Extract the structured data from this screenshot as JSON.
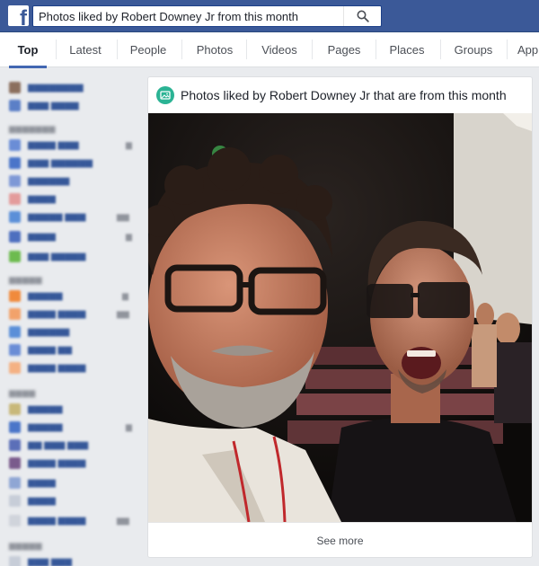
{
  "search": {
    "query": "Photos liked by Robert Downey Jr from this month"
  },
  "tabs": [
    {
      "label": "Top"
    },
    {
      "label": "Latest"
    },
    {
      "label": "People"
    },
    {
      "label": "Photos"
    },
    {
      "label": "Videos"
    },
    {
      "label": "Pages"
    },
    {
      "label": "Places"
    },
    {
      "label": "Groups"
    },
    {
      "label": "App"
    }
  ],
  "card": {
    "title": "Photos liked by Robert Downey Jr that are from this month",
    "see_more": "See more"
  },
  "colors": {
    "brand": "#3b5998",
    "tab_underline": "#4267b2",
    "card_icon": "#2bb394"
  }
}
